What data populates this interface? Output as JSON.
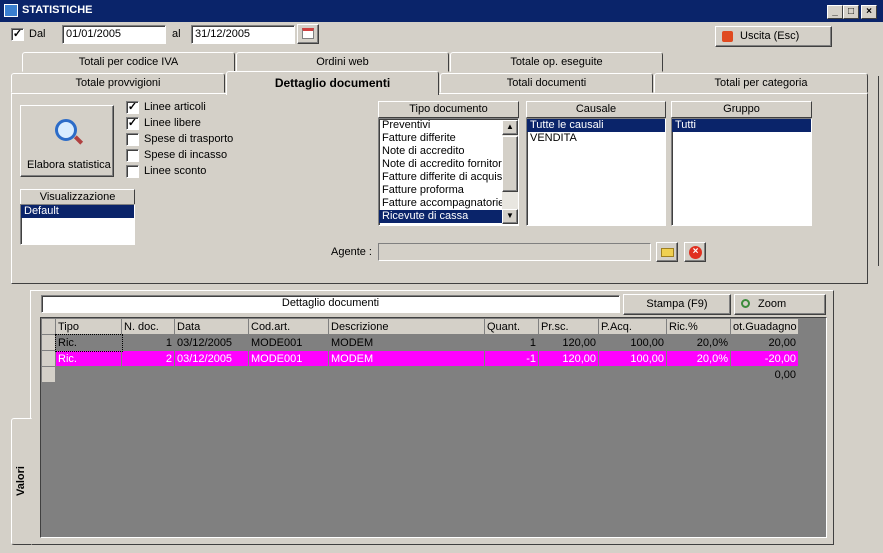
{
  "window": {
    "title": "STATISTICHE"
  },
  "filter": {
    "dal_label": "Dal",
    "dal_checked": "✓",
    "from_date": "01/01/2005",
    "al_label": "al",
    "to_date": "31/12/2005"
  },
  "exit_button": "Uscita (Esc)",
  "tabs_row1": [
    "Totali per codice IVA",
    "Ordini web",
    "Totale op. eseguite"
  ],
  "tabs_row2": [
    "Totale provvigioni",
    "Dettaglio documenti",
    "Totali documenti",
    "Totali per categoria"
  ],
  "elabora_label": "Elabora statistica",
  "options": [
    {
      "label": "Linee articoli",
      "checked": "✓"
    },
    {
      "label": "Linee libere",
      "checked": "✓"
    },
    {
      "label": "Spese di trasporto",
      "checked": ""
    },
    {
      "label": "Spese di incasso",
      "checked": ""
    },
    {
      "label": "Linee sconto",
      "checked": ""
    }
  ],
  "visualizzazione": {
    "header": "Visualizzazione",
    "items": [
      "Default"
    ]
  },
  "tipo_documento": {
    "header": "Tipo documento",
    "items": [
      "Preventivi",
      "Fatture differite",
      "Note di accredito",
      "Note di accredito fornitori",
      "Fatture differite di acquisto",
      "Fatture proforma",
      "Fatture accompagnatorie",
      "Ricevute di cassa"
    ]
  },
  "causale": {
    "header": "Causale",
    "items": [
      "Tutte le causali",
      "VENDITA"
    ]
  },
  "gruppo": {
    "header": "Gruppo",
    "items": [
      "Tutti"
    ]
  },
  "agente": {
    "label": "Agente :",
    "value": ""
  },
  "lower": {
    "side_tab": "Valori",
    "title": "Dettaglio documenti",
    "stampa": "Stampa (F9)",
    "zoom": "Zoom"
  },
  "table": {
    "columns": [
      "Tipo",
      "N. doc.",
      "Data",
      "Cod.art.",
      "Descrizione",
      "Quant.",
      "Pr.sc.",
      "P.Acq.",
      "Ric.%",
      "ot.Guadagno"
    ],
    "rows": [
      [
        "Ric.",
        "1",
        "03/12/2005",
        "MODE001",
        "MODEM",
        "1",
        "120,00",
        "100,00",
        "20,0%",
        "20,00"
      ],
      [
        "Ric.",
        "2",
        "03/12/2005",
        "MODE001",
        "MODEM",
        "-1",
        "120,00",
        "100,00",
        "20,0%",
        "-20,00"
      ],
      [
        "",
        "",
        "",
        "",
        "",
        "",
        "",
        "",
        "",
        "0,00"
      ]
    ]
  },
  "colors": {
    "title_bg": "#0a246a",
    "selection": "#0a246a",
    "highlight_row": "#ff00ff",
    "face": "#d4d0c8"
  }
}
